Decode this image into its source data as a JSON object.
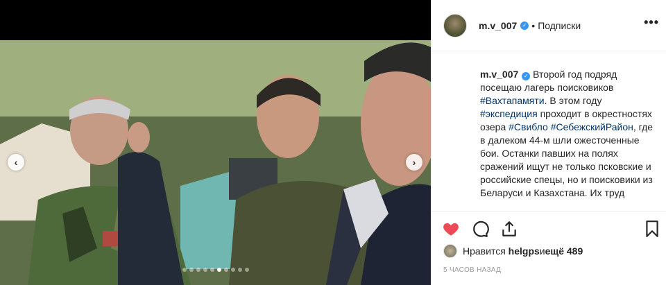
{
  "post": {
    "username": "m.v_007",
    "follow_label": "Подписки",
    "more_label": "•••",
    "caption": {
      "username": "m.v_007",
      "parts": [
        {
          "t": "text",
          "v": " Второй год подряд посещаю лагерь поисковиков "
        },
        {
          "t": "tag",
          "v": "#Вахтапамяти"
        },
        {
          "t": "text",
          "v": ". В этом году "
        },
        {
          "t": "tag",
          "v": "#экспедиция"
        },
        {
          "t": "text",
          "v": " проходит в окрестностях озера "
        },
        {
          "t": "tag",
          "v": "#Свибло"
        },
        {
          "t": "text",
          "v": " "
        },
        {
          "t": "tag",
          "v": "#СебежскийРайон"
        },
        {
          "t": "text",
          "v": ", где в далеком 44-м шли ожесточенные бои. Останки павших на полях сражений ищут не только псковские и российские спецы, но и поисковики из Беларуси и Казахстана. Их труд"
        }
      ]
    },
    "likes": {
      "prefix": "Нравится",
      "user": "helgps",
      "middle": " и ",
      "count": "ещё 489"
    },
    "time": "5 ЧАСОВ НАЗАД",
    "carousel": {
      "slides": 10,
      "active": 5
    }
  }
}
